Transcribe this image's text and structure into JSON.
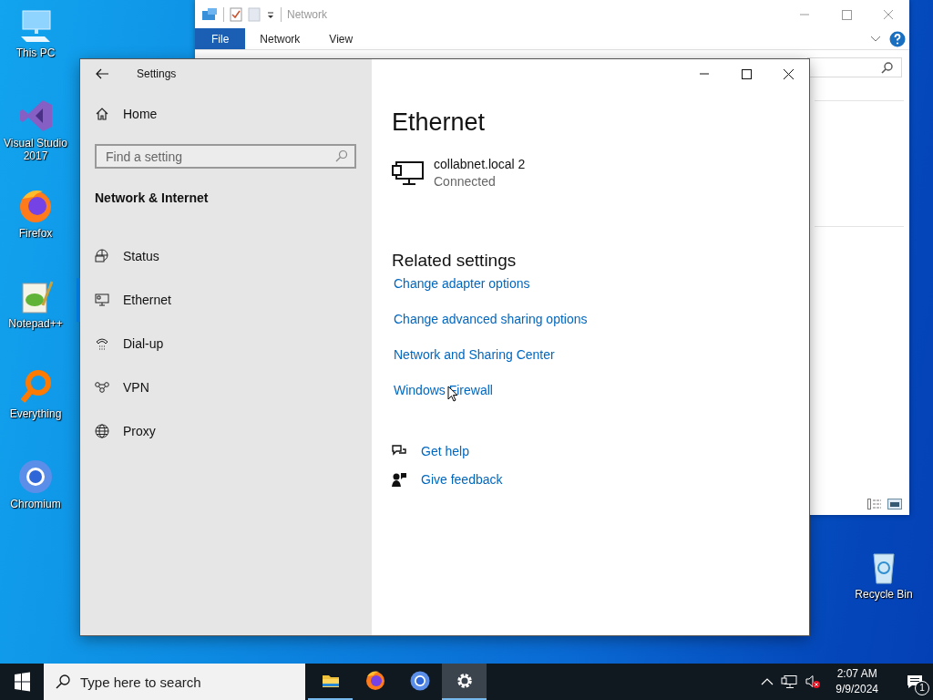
{
  "desktop_icons": [
    {
      "kind": "computer",
      "label": "This PC"
    },
    {
      "kind": "visualstudio",
      "label": "Visual Studio 2017"
    },
    {
      "kind": "firefox",
      "label": "Firefox"
    },
    {
      "kind": "notepad",
      "label": "Notepad++"
    },
    {
      "kind": "everything",
      "label": "Everything"
    },
    {
      "kind": "chromium",
      "label": "Chromium"
    }
  ],
  "recycle_bin": {
    "label": "Recycle Bin"
  },
  "explorer": {
    "title": "Network",
    "ribbon_tabs": [
      {
        "label": "File",
        "selected": true
      },
      {
        "label": "Network",
        "selected": false
      },
      {
        "label": "View",
        "selected": false
      }
    ]
  },
  "settings": {
    "title": "Settings",
    "home": "Home",
    "search": {
      "placeholder": "Find a setting"
    },
    "section": "Network & Internet",
    "nav": [
      {
        "kind": "status",
        "label": "Status",
        "selected": false
      },
      {
        "kind": "ethernet",
        "label": "Ethernet",
        "selected": true
      },
      {
        "kind": "dialup",
        "label": "Dial-up",
        "selected": false
      },
      {
        "kind": "vpn",
        "label": "VPN",
        "selected": false
      },
      {
        "kind": "proxy",
        "label": "Proxy",
        "selected": false
      }
    ],
    "page_title": "Ethernet",
    "connection": {
      "name": "collabnet.local 2",
      "status": "Connected"
    },
    "related_heading": "Related settings",
    "related_links": [
      "Change adapter options",
      "Change advanced sharing options",
      "Network and Sharing Center",
      "Windows Firewall"
    ],
    "help_links": [
      {
        "kind": "help",
        "label": "Get help"
      },
      {
        "kind": "feedback",
        "label": "Give feedback"
      }
    ]
  },
  "taskbar": {
    "search": {
      "placeholder": "Type here to search"
    },
    "apps": [
      {
        "kind": "explorer",
        "open": true,
        "selected": false
      },
      {
        "kind": "firefox",
        "open": false,
        "selected": false
      },
      {
        "kind": "chromium",
        "open": false,
        "selected": false
      },
      {
        "kind": "settings",
        "open": true,
        "selected": true
      }
    ],
    "time": "2:07 AM",
    "date": "9/9/2024",
    "notification_count": "1"
  }
}
